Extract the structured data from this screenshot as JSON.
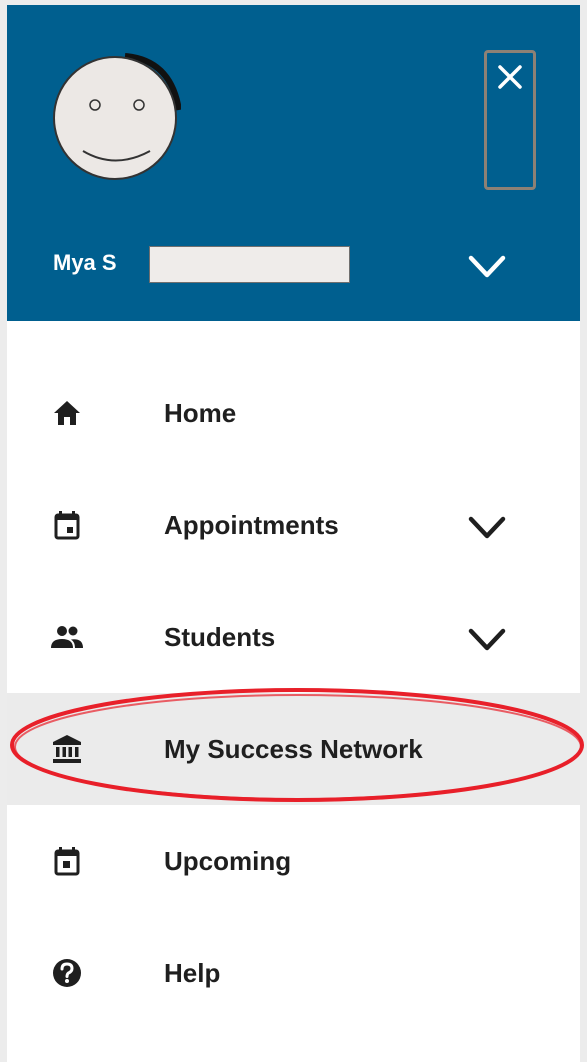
{
  "user": {
    "name": "Mya S",
    "menu_icon": "chevron-down-icon",
    "avatar_icon": "avatar-face-icon"
  },
  "header": {
    "close_icon": "close-icon",
    "background_color": "#005f8f"
  },
  "nav": {
    "items": [
      {
        "label": "Home",
        "icon": "home-icon",
        "expandable": false,
        "active": false
      },
      {
        "label": "Appointments",
        "icon": "calendar-icon",
        "expandable": true,
        "active": false
      },
      {
        "label": "Students",
        "icon": "people-icon",
        "expandable": true,
        "active": false
      },
      {
        "label": "My Success Network",
        "icon": "bank-icon",
        "expandable": false,
        "active": true
      },
      {
        "label": "Upcoming",
        "icon": "calendar-icon",
        "expandable": false,
        "active": false
      },
      {
        "label": "Help",
        "icon": "help-icon",
        "expandable": false,
        "active": false
      }
    ]
  },
  "annotation": {
    "color": "#e8202a",
    "target": "My Success Network"
  }
}
